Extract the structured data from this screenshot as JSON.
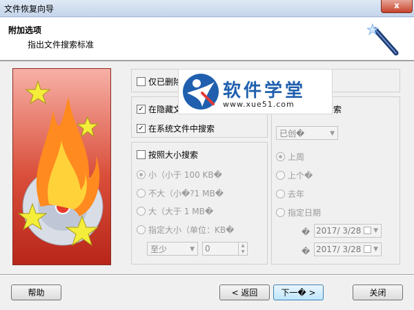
{
  "window": {
    "title": "文件恢复向导",
    "close_label": "x"
  },
  "header": {
    "title": "附加选项",
    "subtitle": "指出文件搜索标准"
  },
  "options": {
    "only_deleted_label": "仅已删除",
    "search_hidden_label": "在隐藏文",
    "search_system_label": "在系统文件中搜索",
    "size_search_label": "按照大小搜索",
    "size_small": "小（小于 100 KB�",
    "size_medium": "不大（小�?1 MB�",
    "size_large": "大（大于 1 MB�",
    "size_custom": "指定大小（单位：KB�",
    "size_mode_value": "至少",
    "size_value": "0",
    "date_right_label": "索"
  },
  "date_panel": {
    "mode_value": "已创�",
    "last_week": "上周",
    "last_month": "上个�",
    "last_year": "去年",
    "custom": "指定日期",
    "date_from_value": "2017/  3/28",
    "date_to_value": "2017/  3/28",
    "from_glyph": "�",
    "to_glyph": "�"
  },
  "logo": {
    "brand": "软件学堂",
    "url": "www.xue51.com"
  },
  "buttons": {
    "help": "帮助",
    "back": "< 返回",
    "next": "下一� >",
    "close": "关闭"
  },
  "colors": {
    "accent": "#1f5fae",
    "picture": "#d94e3a"
  }
}
